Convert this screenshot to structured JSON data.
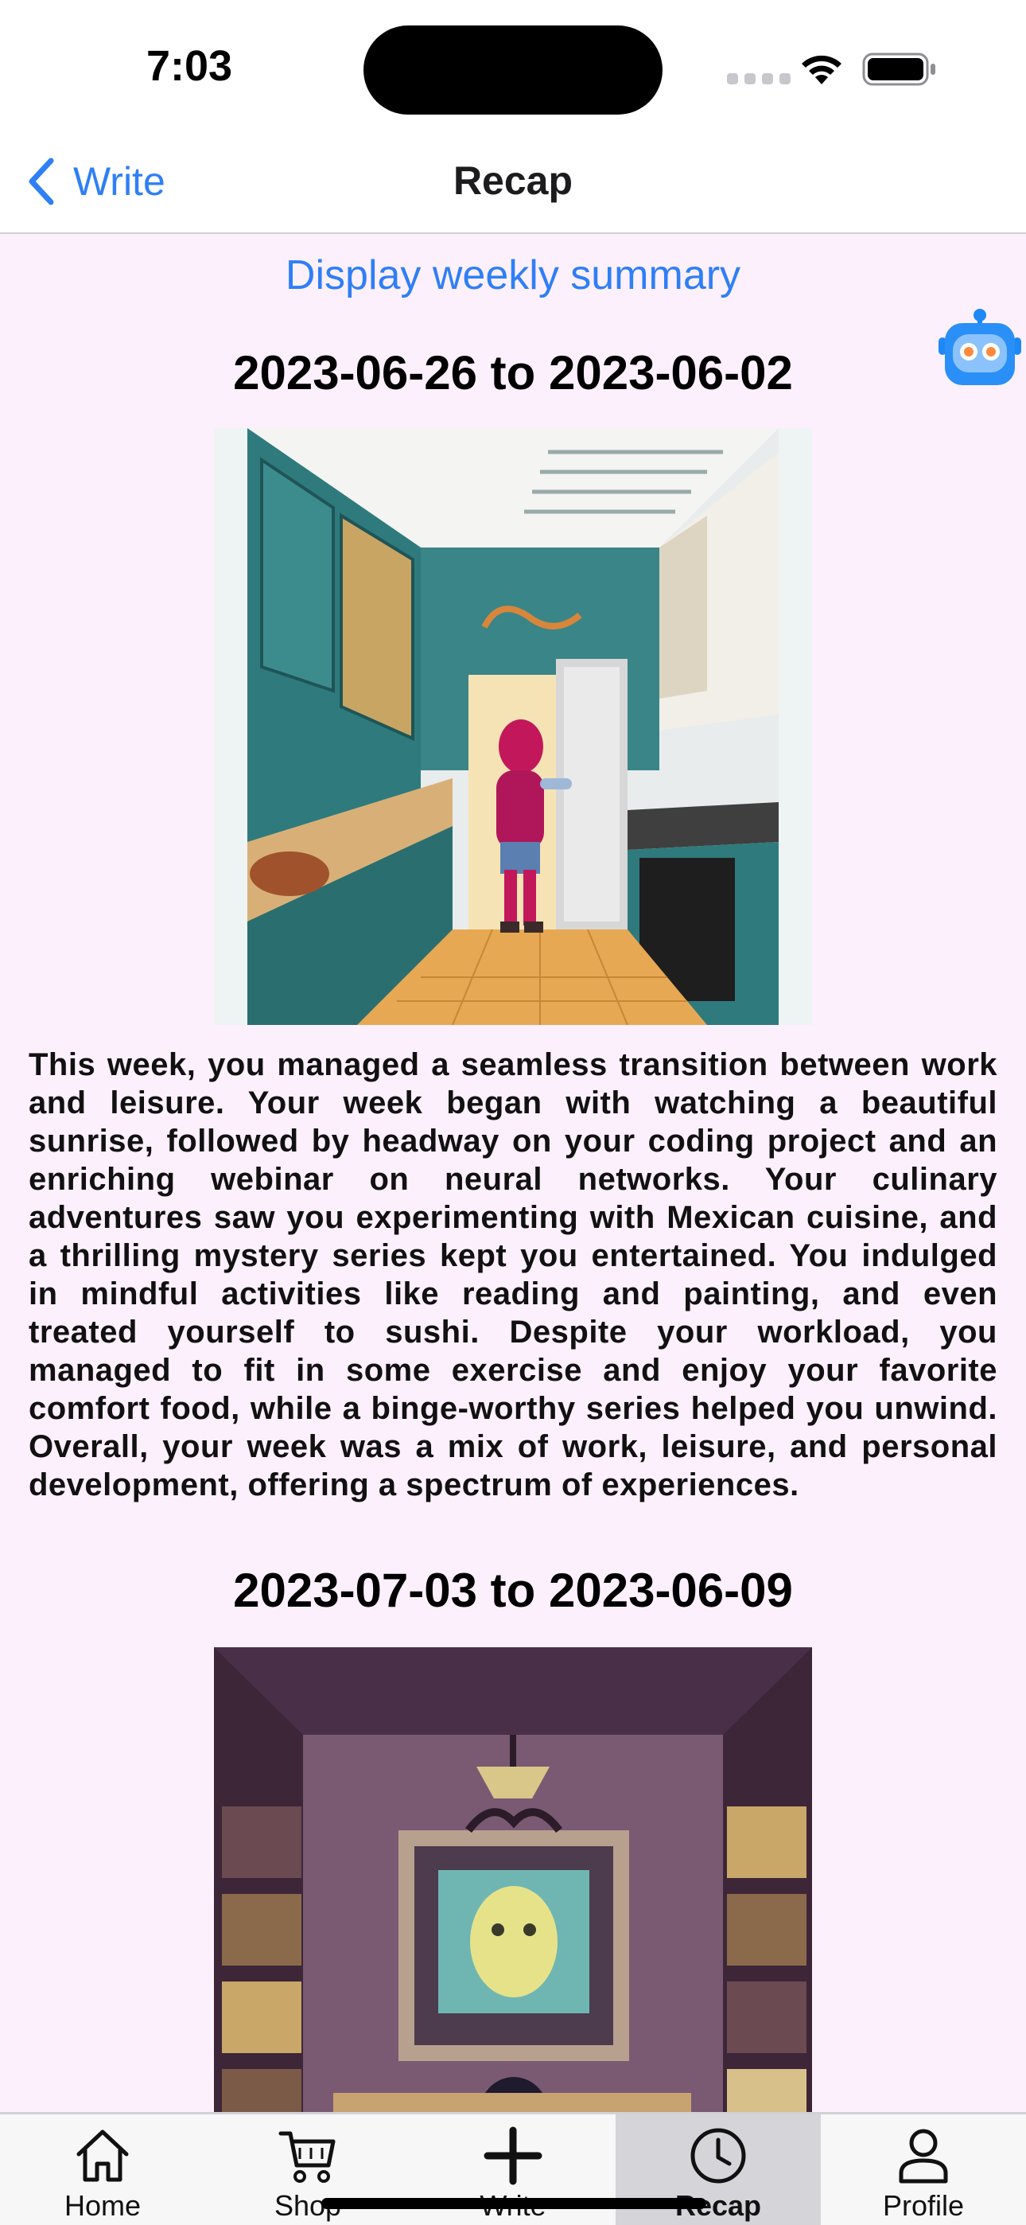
{
  "status_bar": {
    "time": "7:03"
  },
  "nav": {
    "back_label": "Write",
    "title": "Recap"
  },
  "content": {
    "summary_link": "Display weekly summary",
    "weeks": [
      {
        "date_range": "2023-06-26 to 2023-06-02",
        "image_desc": "kitchen-illustration",
        "summary": "This week, you managed a seamless transition between work and leisure. Your week began with watching a beautiful sunrise, followed by headway on your coding project and an enriching webinar on neural networks. Your culinary adventures saw you experimenting with Mexican cuisine, and a thrilling mystery series kept you entertained. You indulged in mindful activities like reading and painting, and even treated yourself to sushi. Despite your workload, you managed to fit in some exercise and enjoy your favorite comfort food, while a binge-worthy series helped you unwind. Overall, your week was a mix of work, leisure, and personal development, offering a spectrum of experiences."
      },
      {
        "date_range": "2023-07-03 to 2023-06-09",
        "image_desc": "study-room-illustration"
      }
    ]
  },
  "tab_bar": {
    "tabs": [
      {
        "label": "Home",
        "icon": "house-icon"
      },
      {
        "label": "Shop",
        "icon": "cart-icon"
      },
      {
        "label": "Write",
        "icon": "plus-icon"
      },
      {
        "label": "Recap",
        "icon": "clock-icon"
      },
      {
        "label": "Profile",
        "icon": "person-icon"
      }
    ],
    "active_tab": "Recap"
  },
  "colors": {
    "accent": "#2f7ff5",
    "content_background": "#fdf0fd",
    "active_tab_background": "#d4d4d9"
  }
}
